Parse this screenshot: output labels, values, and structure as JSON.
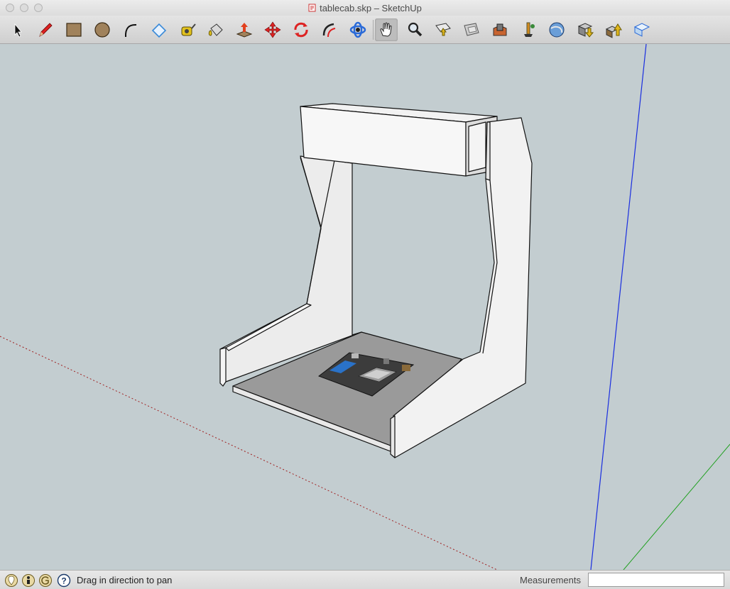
{
  "window": {
    "title": "tablecab.skp – SketchUp"
  },
  "toolbar": {
    "tools": [
      {
        "name": "select-tool",
        "icon": "arrow-icon"
      },
      {
        "name": "pencil-tool",
        "icon": "pencil-icon"
      },
      {
        "name": "rectangle-tool",
        "icon": "rectangle-icon"
      },
      {
        "name": "circle-tool",
        "icon": "circle-icon"
      },
      {
        "name": "arc-tool",
        "icon": "arc-icon"
      },
      {
        "name": "eraser-tool",
        "icon": "eraser-icon"
      },
      {
        "name": "tape-measure-tool",
        "icon": "tape-measure-icon"
      },
      {
        "name": "paint-bucket-tool",
        "icon": "paint-bucket-icon"
      },
      {
        "name": "push-pull-tool",
        "icon": "push-pull-icon"
      },
      {
        "name": "move-tool",
        "icon": "move-icon"
      },
      {
        "name": "rotate-tool",
        "icon": "rotate-icon"
      },
      {
        "name": "follow-me-tool",
        "icon": "follow-me-icon"
      },
      {
        "name": "orbit-tool",
        "icon": "orbit-icon"
      },
      {
        "name": "pan-tool",
        "icon": "hand-icon",
        "active": true
      },
      {
        "name": "zoom-tool",
        "icon": "magnifier-icon"
      },
      {
        "name": "zoom-extents-tool",
        "icon": "zoom-extents-icon"
      },
      {
        "name": "previous-view-tool",
        "icon": "previous-view-icon"
      },
      {
        "name": "warehouse-tool",
        "icon": "warehouse-icon"
      },
      {
        "name": "extension-tool",
        "icon": "extension-icon"
      },
      {
        "name": "google-earth-tool",
        "icon": "globe-icon"
      },
      {
        "name": "get-models-tool",
        "icon": "get-models-icon"
      },
      {
        "name": "share-model-tool",
        "icon": "share-model-icon"
      },
      {
        "name": "layout-tool",
        "icon": "layout-icon"
      }
    ]
  },
  "status": {
    "hint": "Drag in direction to pan",
    "measurements_label": "Measurements",
    "measurements_value": ""
  },
  "colors": {
    "viewport_bg": "#c3cdd0",
    "blue_axis": "#1a2ee0",
    "green_axis": "#1fa01f",
    "red_axis": "#a02020"
  }
}
